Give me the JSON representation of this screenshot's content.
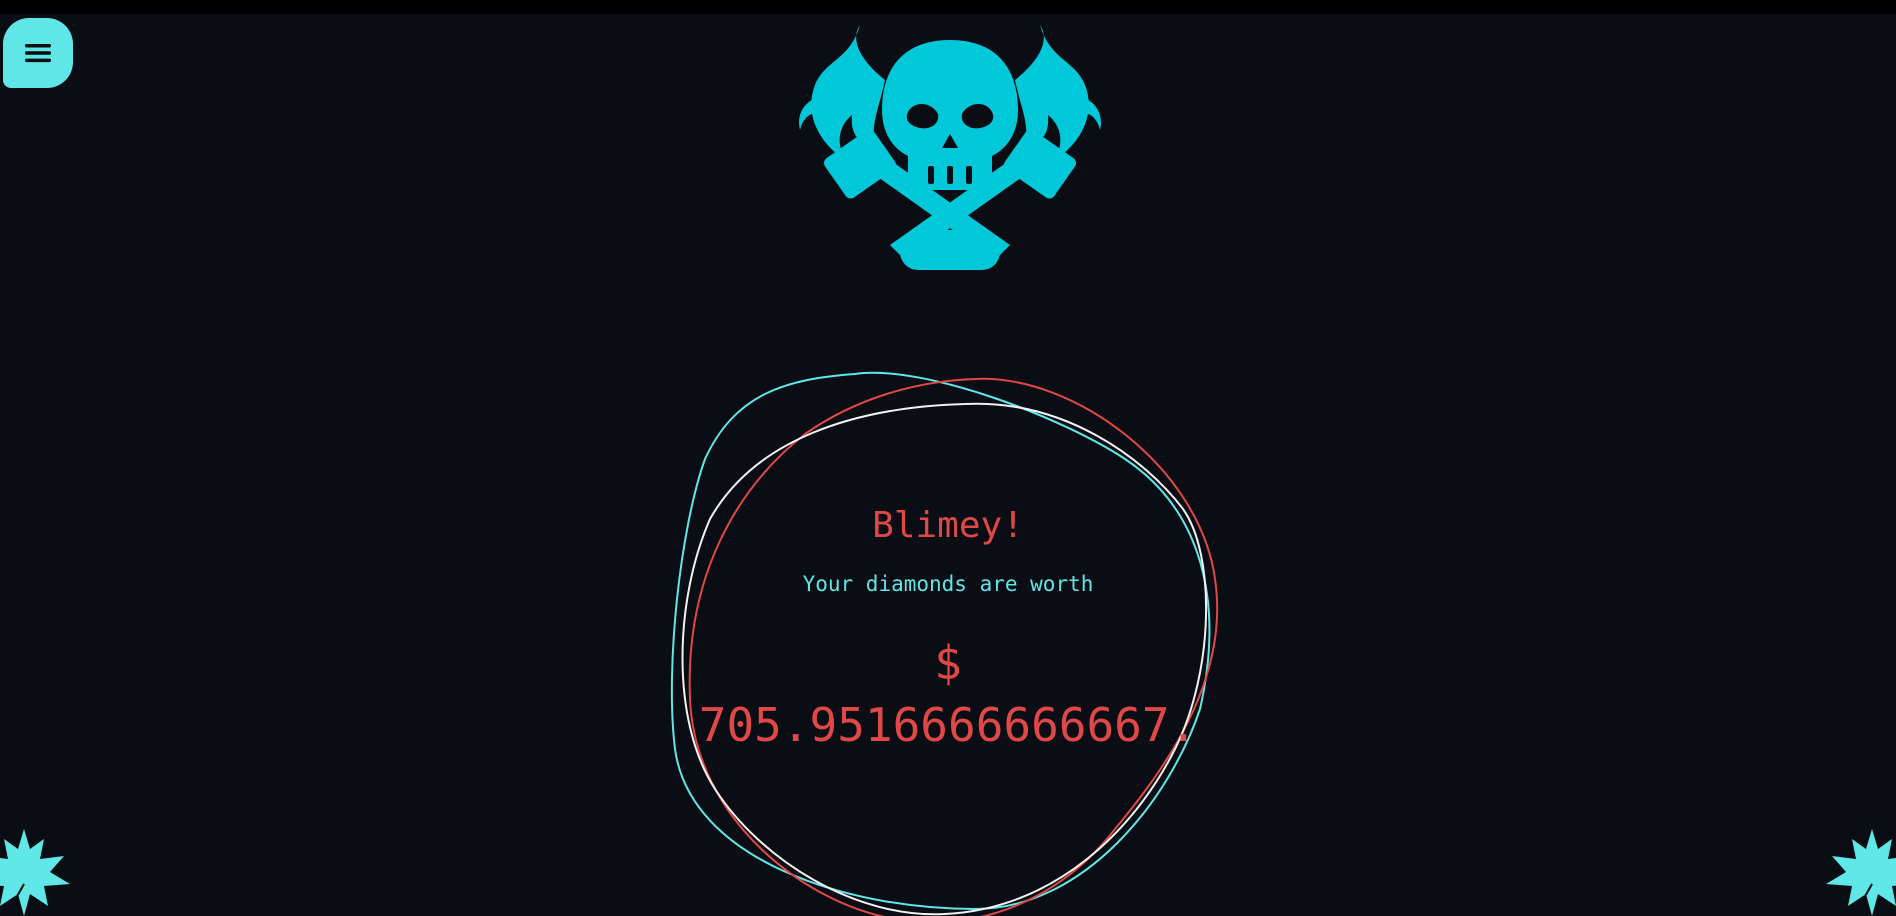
{
  "header": {
    "menu_icon": "hamburger-menu-icon",
    "logo_icon": "skull-crossed-hammers-flames-icon"
  },
  "result": {
    "title": "Blimey!",
    "subtitle": "Your diamonds are worth",
    "currency": "$",
    "amount": "705.9516666666667."
  },
  "decorations": {
    "corner_icon": "maple-leaf-icon"
  },
  "colors": {
    "background": "#0a0d13",
    "accent_cyan": "#5fe6e6",
    "logo_cyan": "#00c8d8",
    "accent_red": "#e04848",
    "ring_white": "#f2f2f2"
  }
}
